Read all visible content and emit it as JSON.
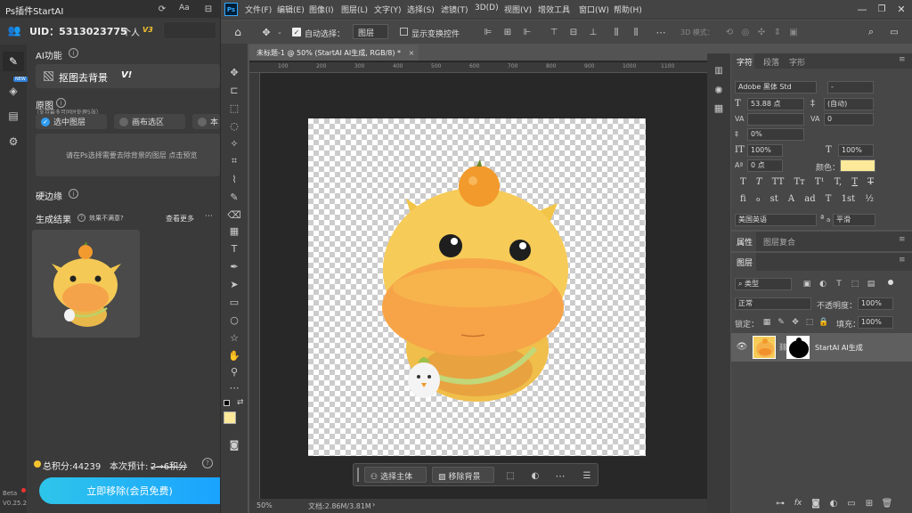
{
  "plugin": {
    "title": "Ps插件StartAI",
    "uid": "UID：5313023775",
    "plan": "个人",
    "plan_badge": "V3",
    "aa": "Aa",
    "ai_section": "AI功能",
    "feature": "抠图去背景",
    "feature_badge": "V!",
    "original_label": "原图",
    "original_hint": "（支持最多可同时处理5张）",
    "opt_selected_layer": "选中图层",
    "opt_canvas_selection": "画布选区",
    "opt_local": "本",
    "upload_hint": "请在Ps选择需要去除背景的图层 点击预览",
    "hard_edge": "硬边缘",
    "result_label": "生成结果",
    "result_help": "效果不满意?",
    "view_more": "查看更多",
    "points": "总积分:44239",
    "estimate": "本次预计:",
    "estimate_value": "2→6积分",
    "action": "立即移除(会员免费)",
    "beta": "Beta",
    "version": "V0.25.2",
    "new_badge": "NEW"
  },
  "ps": {
    "logo": "Ps",
    "menu": [
      "文件(F)",
      "编辑(E)",
      "图像(I)",
      "图层(L)",
      "文字(Y)",
      "选择(S)",
      "滤镜(T)",
      "3D(D)",
      "视图(V)",
      "增效工具",
      "窗口(W)",
      "帮助(H)"
    ],
    "auto_select": "自动选择：",
    "auto_select_target": "图层",
    "show_transform": "显示变换控件",
    "mode_3d": "3D 模式：",
    "doc_tab": "未标题-1 @ 50% (StartAI AI生成, RGB/8) *",
    "ruler_marks": [
      "100",
      "150",
      "200",
      "250",
      "300",
      "350",
      "400",
      "450",
      "500",
      "550",
      "600",
      "650",
      "700",
      "750",
      "800",
      "850",
      "900",
      "950",
      "1000",
      "1050",
      "1100"
    ],
    "zoom": "50%",
    "doc_info": "文档:2.86M/3.81M",
    "ctx_select_subject": "选择主体",
    "ctx_remove_bg": "移除背景"
  },
  "char": {
    "tabs": [
      "字符",
      "段落",
      "字形"
    ],
    "font": "Adobe 黑体 Std",
    "style": "-",
    "size": "53.88 点",
    "leading": "(自动)",
    "kerning": "",
    "tracking": "0",
    "scale_pct": "0%",
    "vscale": "100%",
    "hscale": "100%",
    "baseline": "0 点",
    "color_label": "颜色：",
    "color": "#fde99a",
    "lang": "美国英语",
    "aa_mode": "平滑",
    "aa_label": "a",
    "style_glyphs": [
      "T",
      "T",
      "TT",
      "Tт",
      "T¹",
      "T,",
      "T",
      "T"
    ],
    "ot_glyphs": [
      "fi",
      "ℴ",
      "st",
      "A",
      "ad",
      "T",
      "1st",
      "½"
    ]
  },
  "props": {
    "tabs": [
      "属性",
      "图层复合"
    ]
  },
  "layers": {
    "tab": "图层",
    "filter": "类型",
    "blend": "正常",
    "opacity_label": "不透明度：",
    "opacity": "100%",
    "lock_label": "锁定：",
    "fill_label": "填充：",
    "fill": "100%",
    "layer_name": "StartAI AI生成"
  },
  "colors": {
    "fg": "#fde99a",
    "accent": "#1aa3ff",
    "cyan": "#2ec5ea"
  }
}
